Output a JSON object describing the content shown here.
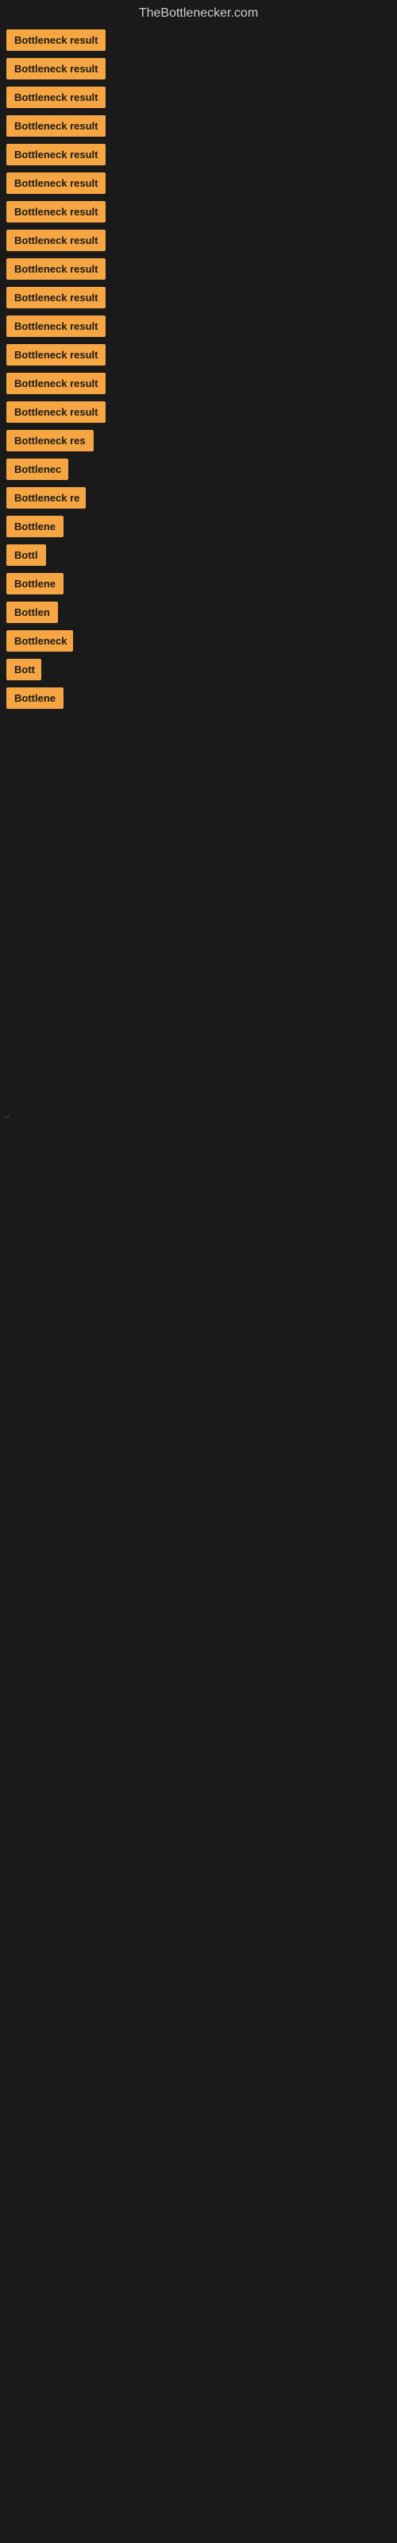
{
  "site": {
    "title": "TheBottlenecker.com"
  },
  "items": [
    {
      "label": "Bottleneck result",
      "width": 140
    },
    {
      "label": "Bottleneck result",
      "width": 140
    },
    {
      "label": "Bottleneck result",
      "width": 140
    },
    {
      "label": "Bottleneck result",
      "width": 140
    },
    {
      "label": "Bottleneck result",
      "width": 140
    },
    {
      "label": "Bottleneck result",
      "width": 140
    },
    {
      "label": "Bottleneck result",
      "width": 140
    },
    {
      "label": "Bottleneck result",
      "width": 140
    },
    {
      "label": "Bottleneck result",
      "width": 140
    },
    {
      "label": "Bottleneck result",
      "width": 140
    },
    {
      "label": "Bottleneck result",
      "width": 140
    },
    {
      "label": "Bottleneck result",
      "width": 140
    },
    {
      "label": "Bottleneck result",
      "width": 140
    },
    {
      "label": "Bottleneck result",
      "width": 140
    },
    {
      "label": "Bottleneck res",
      "width": 110
    },
    {
      "label": "Bottlenec",
      "width": 78
    },
    {
      "label": "Bottleneck re",
      "width": 100
    },
    {
      "label": "Bottlene",
      "width": 72
    },
    {
      "label": "Bottl",
      "width": 52
    },
    {
      "label": "Bottlene",
      "width": 72
    },
    {
      "label": "Bottlen",
      "width": 65
    },
    {
      "label": "Bottleneck",
      "width": 84
    },
    {
      "label": "Bott",
      "width": 44
    },
    {
      "label": "Bottlene",
      "width": 72
    }
  ],
  "dot": "..."
}
